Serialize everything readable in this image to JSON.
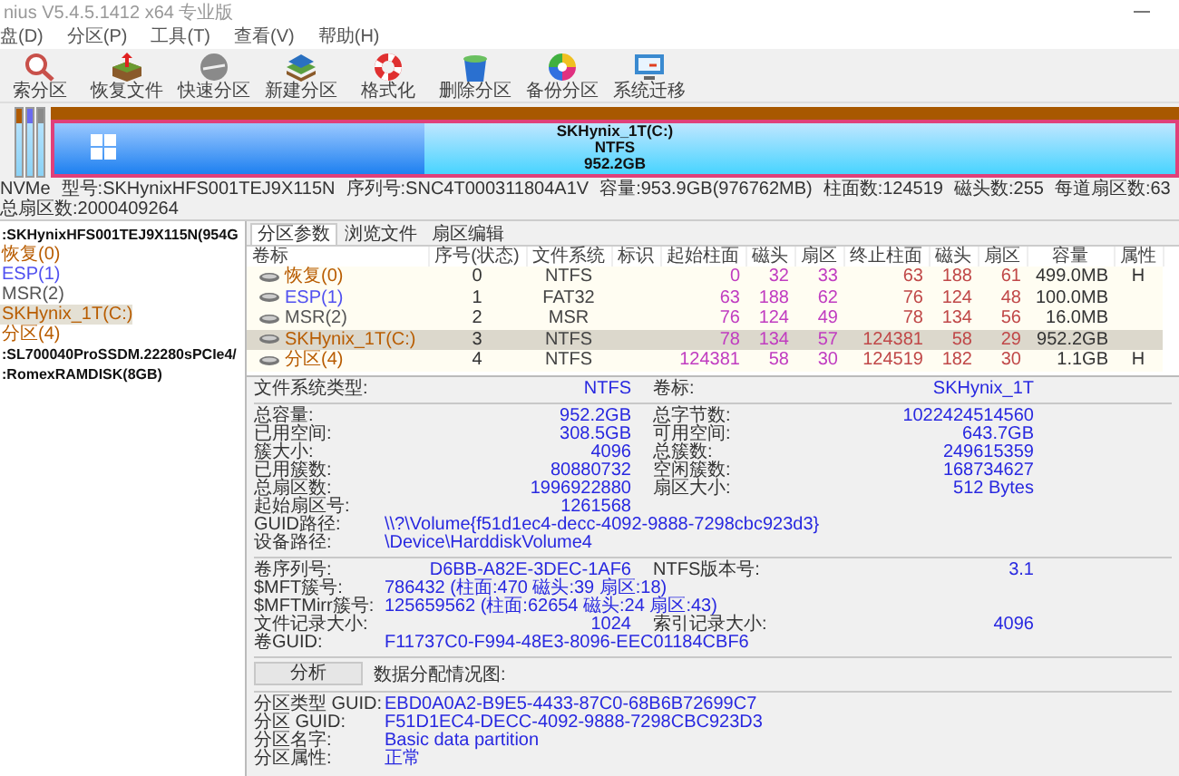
{
  "window": {
    "title": "nius V5.4.5.1412 x64 专业版"
  },
  "menu": [
    "盘(D)",
    "分区(P)",
    "工具(T)",
    "查看(V)",
    "帮助(H)"
  ],
  "toolbar": [
    {
      "label": "索分区"
    },
    {
      "label": "恢复文件"
    },
    {
      "label": "快速分区"
    },
    {
      "label": "新建分区"
    },
    {
      "label": "格式化"
    },
    {
      "label": "删除分区"
    },
    {
      "label": "备份分区"
    },
    {
      "label": "系统迁移"
    }
  ],
  "disk_map": {
    "strips": [
      {
        "color": "#b05a00"
      },
      {
        "color": "#6a6af0"
      },
      {
        "color": "#8a8a8a"
      }
    ],
    "partition": {
      "name": "SKHynix_1T(C:)",
      "fs": "NTFS",
      "size": "952.2GB",
      "level": 0.33,
      "selected": true
    }
  },
  "disk_info": [
    "NVMe",
    "型号:SKHynixHFS001TEJ9X115N",
    "序列号:SNC4T000311804A1V",
    "容量:953.9GB(976762MB)",
    "柱面数:124519",
    "磁头数:255",
    "每道扇区数:63",
    "总扇区数:2000409264"
  ],
  "tree": [
    {
      "label": ":SKHynixHFS001TEJ9X115N(954G",
      "selected": false,
      "children": [
        {
          "label": "恢复(0)",
          "color": "#b85c00",
          "selected": false
        },
        {
          "label": "ESP(1)",
          "color": "#5050f0",
          "selected": false
        },
        {
          "label": "MSR(2)",
          "color": "#555555",
          "selected": false
        },
        {
          "label": "SKHynix_1T(C:)",
          "color": "#b85c00",
          "selected": true
        },
        {
          "label": "分区(4)",
          "color": "#b85c00",
          "selected": false
        }
      ]
    },
    {
      "label": ":SL700040ProSSDM.22280sPCIe4/",
      "selected": false
    },
    {
      "label": ":RomexRAMDISK(8GB)",
      "selected": false
    }
  ],
  "tabs": [
    {
      "label": "分区参数",
      "selected": true
    },
    {
      "label": "浏览文件",
      "selected": false
    },
    {
      "label": "扇区编辑",
      "selected": false
    }
  ],
  "partition_table": {
    "columns": [
      "卷标",
      "序号(状态)",
      "文件系统",
      "标识",
      "起始柱面",
      "磁头",
      "扇区",
      "终止柱面",
      "磁头",
      "扇区",
      "容量",
      "属性"
    ],
    "rows": [
      {
        "label": "恢复(0)",
        "color": "#b85c00",
        "index": "0",
        "fs": "NTFS",
        "start_cyl": "0",
        "start_head": "32",
        "start_sector": "33",
        "end_cyl": "63",
        "end_head": "188",
        "end_sector": "61",
        "size": "499.0MB",
        "attr": "H",
        "selected": false
      },
      {
        "label": "ESP(1)",
        "color": "#5050f0",
        "index": "1",
        "fs": "FAT32",
        "start_cyl": "63",
        "start_head": "188",
        "start_sector": "62",
        "end_cyl": "76",
        "end_head": "124",
        "end_sector": "48",
        "size": "100.0MB",
        "selected": false
      },
      {
        "label": "MSR(2)",
        "color": "#555555",
        "index": "2",
        "fs": "MSR",
        "start_cyl": "76",
        "start_head": "124",
        "start_sector": "49",
        "end_cyl": "78",
        "end_head": "134",
        "end_sector": "56",
        "size": "16.0MB",
        "selected": false
      },
      {
        "label": "SKHynix_1T(C:)",
        "color": "#b85c00",
        "index": "3",
        "fs": "NTFS",
        "start_cyl": "78",
        "start_head": "134",
        "start_sector": "57",
        "end_cyl": "124381",
        "end_head": "58",
        "end_sector": "29",
        "size": "952.2GB",
        "selected": true
      },
      {
        "label": "分区(4)",
        "color": "#b85c00",
        "index": "4",
        "fs": "NTFS",
        "start_cyl": "124381",
        "start_head": "58",
        "start_sector": "30",
        "end_cyl": "124519",
        "end_head": "182",
        "end_sector": "30",
        "size": "1.1GB",
        "attr": "H",
        "selected": false
      }
    ]
  },
  "info_groups": [
    [
      {
        "kind": "pair",
        "label": "文件系统类型:",
        "value": "NTFS",
        "label2": "卷标:",
        "value2": "SKHynix_1T"
      }
    ],
    [
      {
        "kind": "pair",
        "label": "总容量:",
        "value": "952.2GB",
        "label2": "总字节数:",
        "value2": "1022424514560"
      },
      {
        "kind": "pair",
        "label": "已用空间:",
        "value": "308.5GB",
        "label2": "可用空间:",
        "value2": "643.7GB"
      },
      {
        "kind": "pair",
        "label": "簇大小:",
        "value": "4096",
        "label2": "总簇数:",
        "value2": "249615359"
      },
      {
        "kind": "pair",
        "label": "已用簇数:",
        "value": "80880732",
        "label2": "空闲簇数:",
        "value2": "168734627"
      },
      {
        "kind": "pair",
        "label": "总扇区数:",
        "value": "1996922880",
        "label2": "扇区大小:",
        "value2": "512 Bytes"
      },
      {
        "kind": "single",
        "label": "起始扇区号:",
        "value": "1261568"
      },
      {
        "kind": "wide",
        "label": "GUID路径:",
        "value": "\\\\?\\Volume{f51d1ec4-decc-4092-9888-7298cbc923d3}"
      },
      {
        "kind": "wide",
        "label": "设备路径:",
        "value": "\\Device\\HarddiskVolume4"
      }
    ],
    [
      {
        "kind": "pair",
        "label": "卷序列号:",
        "value": "D6BB-A82E-3DEC-1AF6",
        "label2": "NTFS版本号:",
        "value2": "3.1"
      },
      {
        "kind": "wide",
        "label": "$MFT簇号:",
        "value": "786432 (柱面:470 磁头:39 扇区:18)"
      },
      {
        "kind": "wide",
        "label": "$MFTMirr簇号:",
        "value": "125659562 (柱面:62654 磁头:24 扇区:43)"
      },
      {
        "kind": "pair",
        "label": "文件记录大小:",
        "value": "1024",
        "label2": "索引记录大小:",
        "value2": "4096"
      },
      {
        "kind": "wide",
        "label": "卷GUID:",
        "value": "F11737C0-F994-48E3-8096-EEC01184CBF6"
      }
    ]
  ],
  "analysis": {
    "button": "分析",
    "label": "数据分配情况图:"
  },
  "partition_info": [
    {
      "label": "分区类型 GUID:",
      "value": "EBD0A0A2-B9E5-4433-87C0-68B6B72699C7"
    },
    {
      "label": "分区 GUID:",
      "value": "F51D1EC4-DECC-4092-9888-7298CBC923D3"
    },
    {
      "label": "分区名字:",
      "value": "Basic data partition"
    },
    {
      "label": "分区属性:",
      "value": "正常"
    }
  ]
}
